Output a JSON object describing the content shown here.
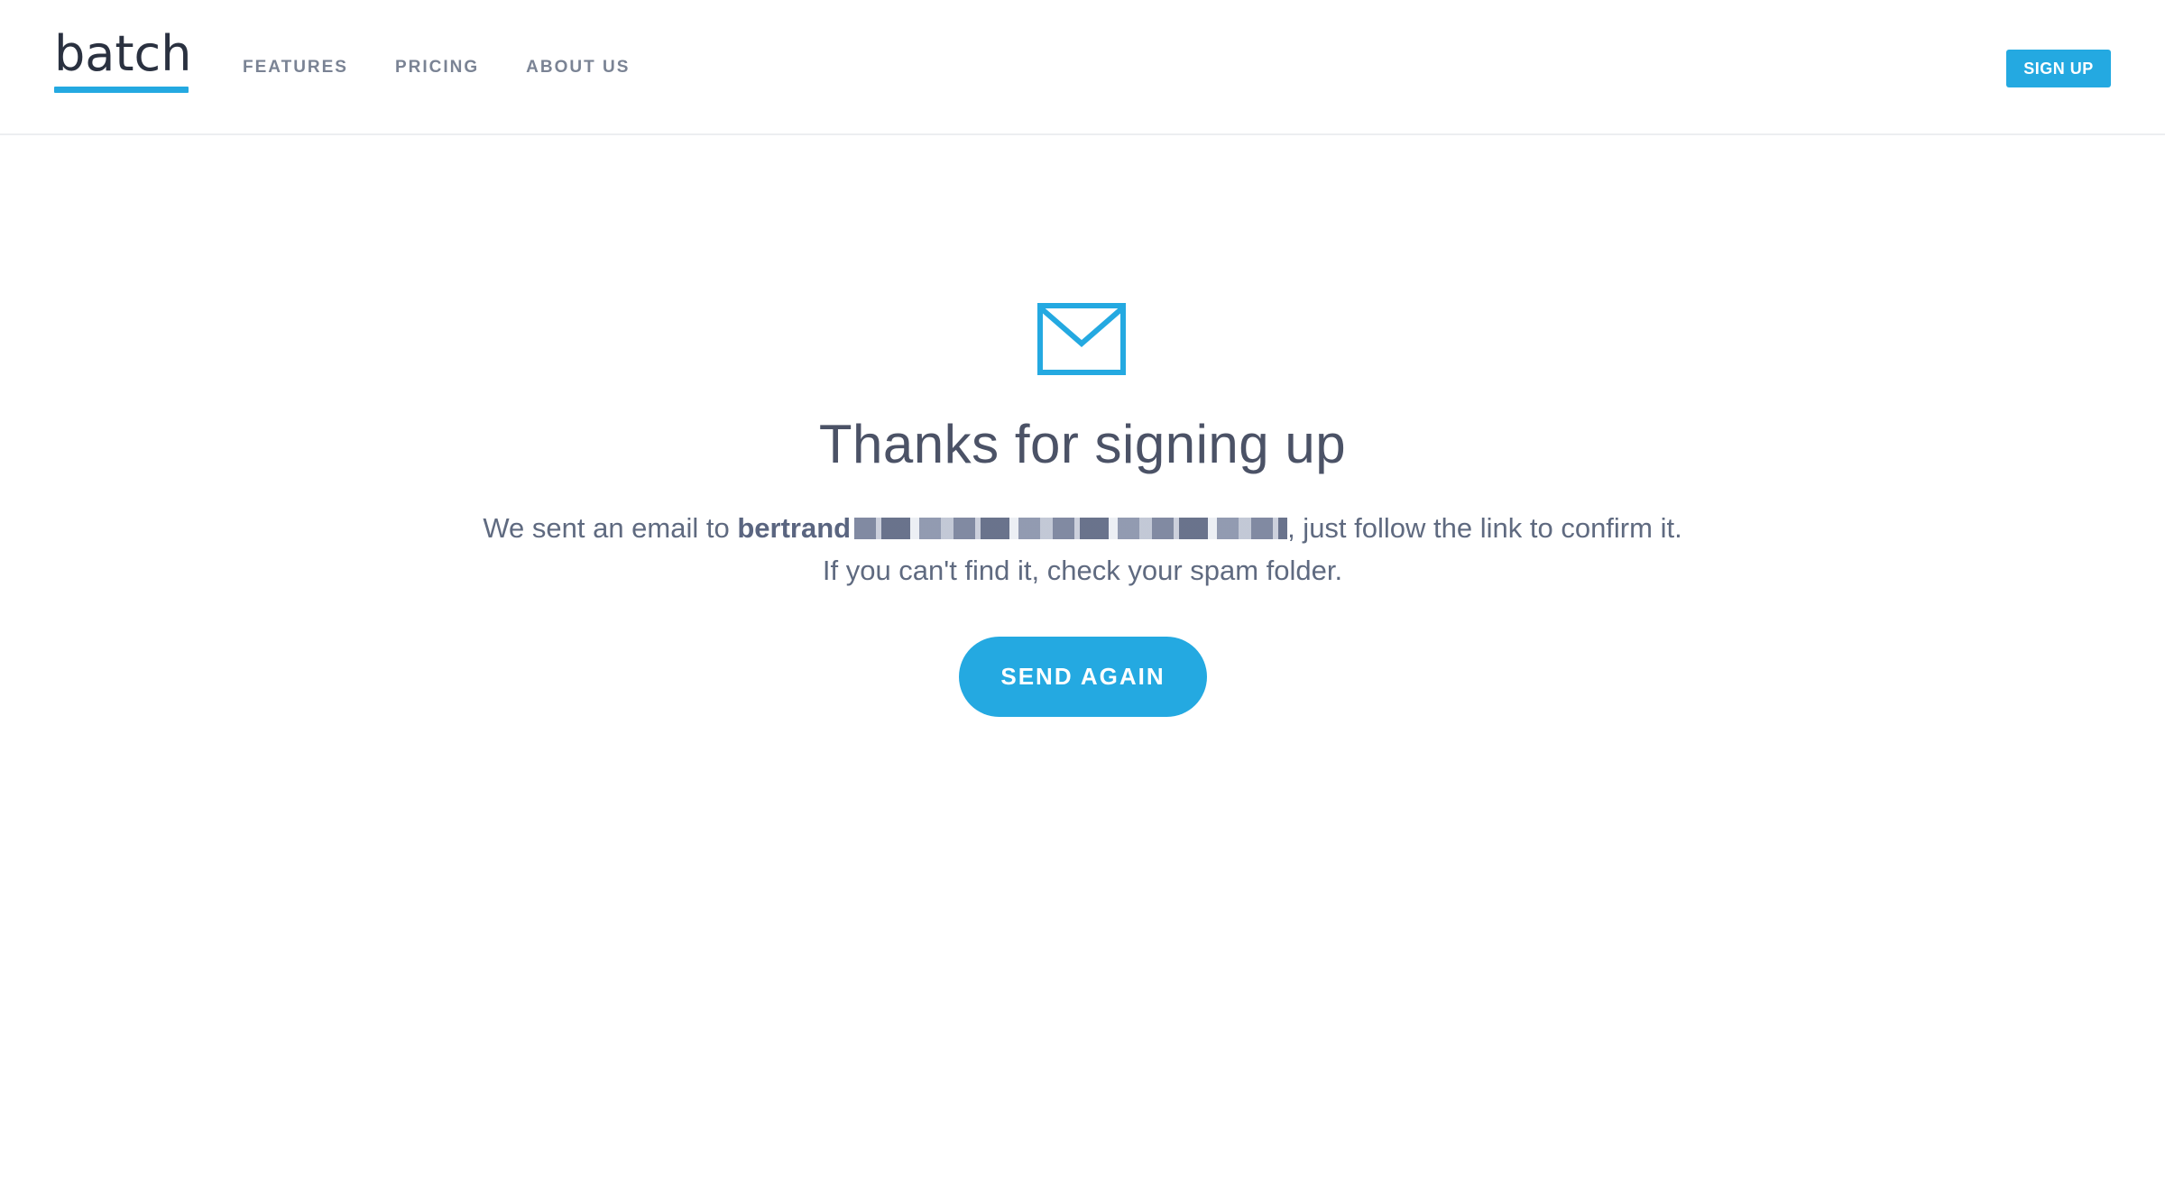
{
  "brand": {
    "logo_text": "batch",
    "accent_color": "#24a9e1",
    "text_color": "#2a3140"
  },
  "nav": {
    "links": [
      {
        "label": "FEATURES"
      },
      {
        "label": "PRICING"
      },
      {
        "label": "ABOUT US"
      }
    ],
    "signup_label": "SIGN UP"
  },
  "confirmation": {
    "icon": "mail-icon",
    "headline": "Thanks for signing up",
    "message_prefix": "We sent an email to ",
    "email_visible": "bertrand",
    "message_suffix": ", just follow the link to confirm it.",
    "message_line2": "If you can't find it, check your spam folder.",
    "send_again_label": "SEND AGAIN"
  }
}
